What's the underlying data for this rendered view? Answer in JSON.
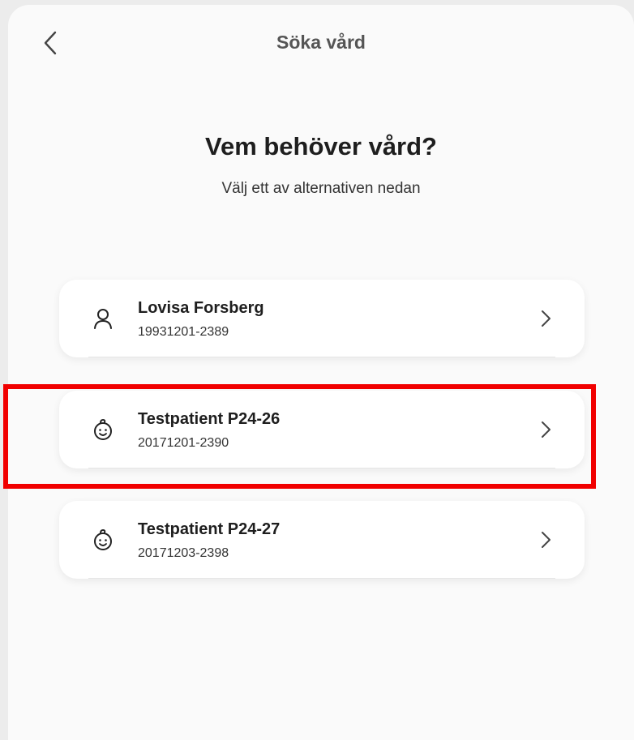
{
  "header": {
    "title": "Söka vård"
  },
  "main": {
    "heading": "Vem behöver vård?",
    "subheading": "Välj ett av alternativen nedan"
  },
  "patients": [
    {
      "name": "Lovisa Forsberg",
      "id": "19931201-2389",
      "icon": "person-icon"
    },
    {
      "name": "Testpatient P24-26",
      "id": "20171201-2390",
      "icon": "child-face-icon"
    },
    {
      "name": "Testpatient P24-27",
      "id": "20171203-2398",
      "icon": "child-face-icon"
    }
  ],
  "colors": {
    "highlight": "#f10000",
    "background": "#fafafa",
    "card": "#ffffff"
  }
}
